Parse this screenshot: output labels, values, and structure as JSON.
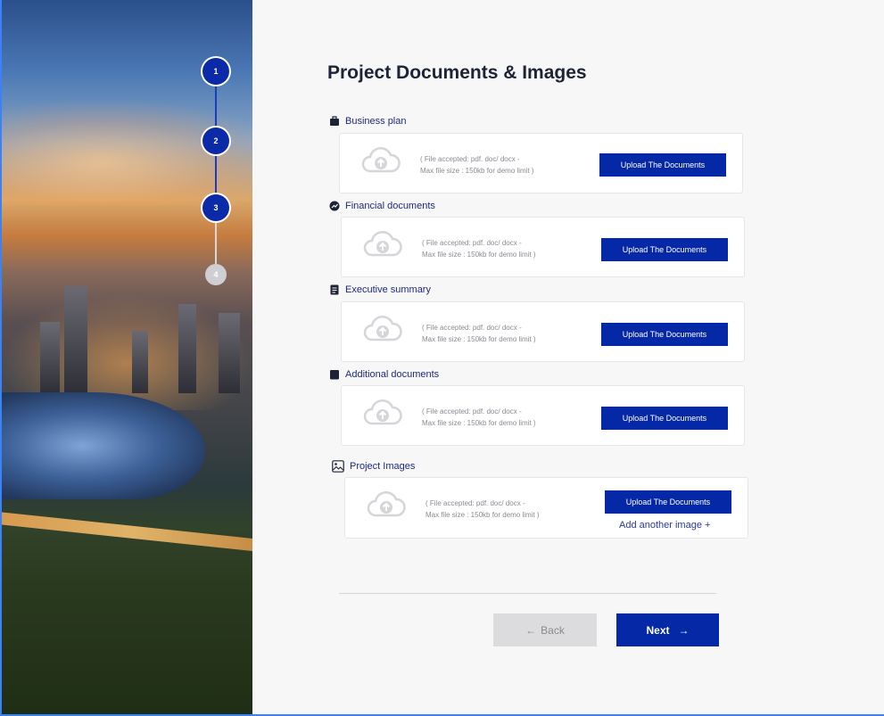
{
  "stepper": {
    "steps": [
      {
        "label": "1",
        "state": "done"
      },
      {
        "label": "2",
        "state": "done"
      },
      {
        "label": "3",
        "state": "done"
      },
      {
        "label": "4",
        "state": "todo"
      }
    ]
  },
  "page": {
    "title": "Project Documents & Images"
  },
  "sections": [
    {
      "label": "Business plan",
      "icon": "briefcase-icon",
      "hint_line1": "( File accepted: pdf. doc/ docx -",
      "hint_line2": "Max file size : 150kb for demo limit )",
      "button": "Upload The Documents"
    },
    {
      "label": "Financial documents",
      "icon": "trend-circle-icon",
      "hint_line1": "( File accepted: pdf. doc/ docx -",
      "hint_line2": "Max file size : 150kb for demo limit )",
      "button": "Upload The Documents"
    },
    {
      "label": "Executive summary",
      "icon": "document-icon",
      "hint_line1": "( File accepted: pdf. doc/ docx -",
      "hint_line2": "Max file size : 150kb for demo limit )",
      "button": "Upload The Documents"
    },
    {
      "label": "Additional documents",
      "icon": "folder-icon",
      "hint_line1": "( File accepted: pdf. doc/ docx -",
      "hint_line2": "Max file size : 150kb for demo limit )",
      "button": "Upload The Documents"
    },
    {
      "label": "Project Images",
      "icon": "image-icon",
      "hint_line1": "( File accepted: pdf. doc/ docx -",
      "hint_line2": "Max file size : 150kb for demo limit )",
      "button": "Upload The Documents",
      "extra_link": "Add another image +"
    }
  ],
  "nav": {
    "back": "Back",
    "back_arrow": "←",
    "next": "Next",
    "next_arrow": "→"
  },
  "colors": {
    "primary": "#0528a6",
    "step_done": "#0a2aa8",
    "step_todo": "#cfcfd3",
    "label": "#1e2a7a"
  }
}
